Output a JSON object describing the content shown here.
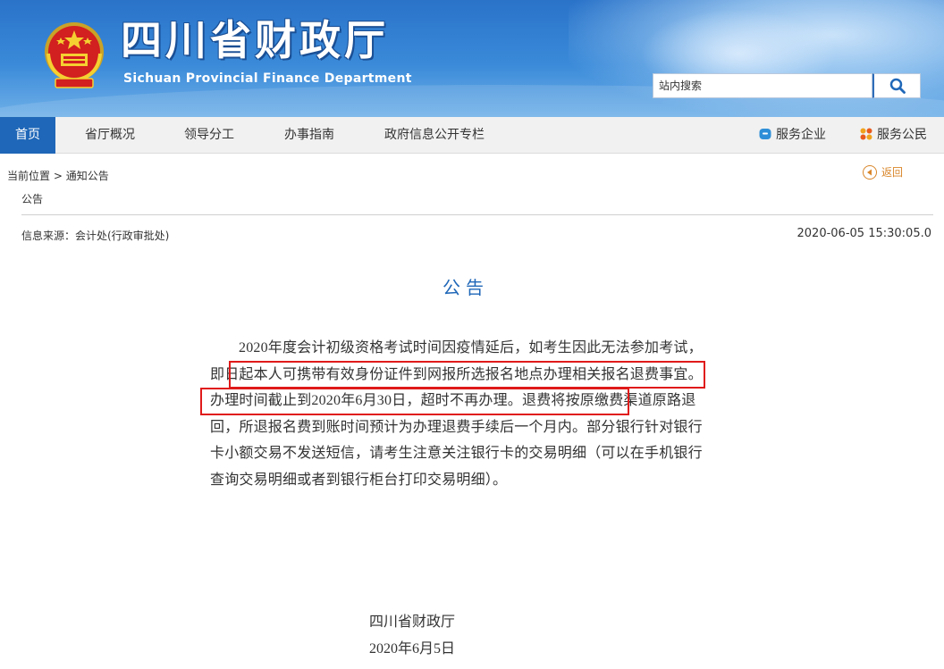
{
  "header": {
    "title": "四川省财政厅",
    "subtitle": "Sichuan Provincial Finance Department",
    "search": {
      "placeholder": "站内搜索",
      "button_icon": "search-icon"
    }
  },
  "nav": {
    "items": [
      {
        "label": "首页",
        "active": true
      },
      {
        "label": "省厅概况"
      },
      {
        "label": "领导分工"
      },
      {
        "label": "办事指南"
      },
      {
        "label": "政府信息公开专栏"
      }
    ],
    "right": [
      {
        "label": "服务企业",
        "icon": "service-enterprise-icon"
      },
      {
        "label": "服务公民",
        "icon": "service-citizen-icon"
      }
    ]
  },
  "breadcrumb": {
    "prefix": "当前位置",
    "separator": ">",
    "current": "通知公告"
  },
  "back_label": "返回",
  "category": "公告",
  "source": "信息来源：会计处(行政审批处)",
  "datetime": "2020-06-05 15:30:05.0",
  "article": {
    "title": "公告",
    "body": "2020年度会计初级资格考试时间因疫情延后，如考生因此无法参加考试，即日起本人可携带有效身份证件到网报所选报名地点办理相关报名退费事宜。办理时间截止到2020年6月30日，超时不再办理。退费将按原缴费渠道原路退回，所退报名费到账时间预计为办理退费手续后一个月内。部分银行针对银行卡小额交易不发送短信，请考生注意关注银行卡的交易明细（可以在手机银行查询交易明细或者到银行柜台打印交易明细）。",
    "signature_org": "四川省财政厅",
    "signature_date": "2020年6月5日"
  },
  "colors": {
    "nav_active": "#1f67b8",
    "title_blue": "#1f67b8",
    "highlight_red": "#e01a1a",
    "back_orange": "#d9862a"
  }
}
